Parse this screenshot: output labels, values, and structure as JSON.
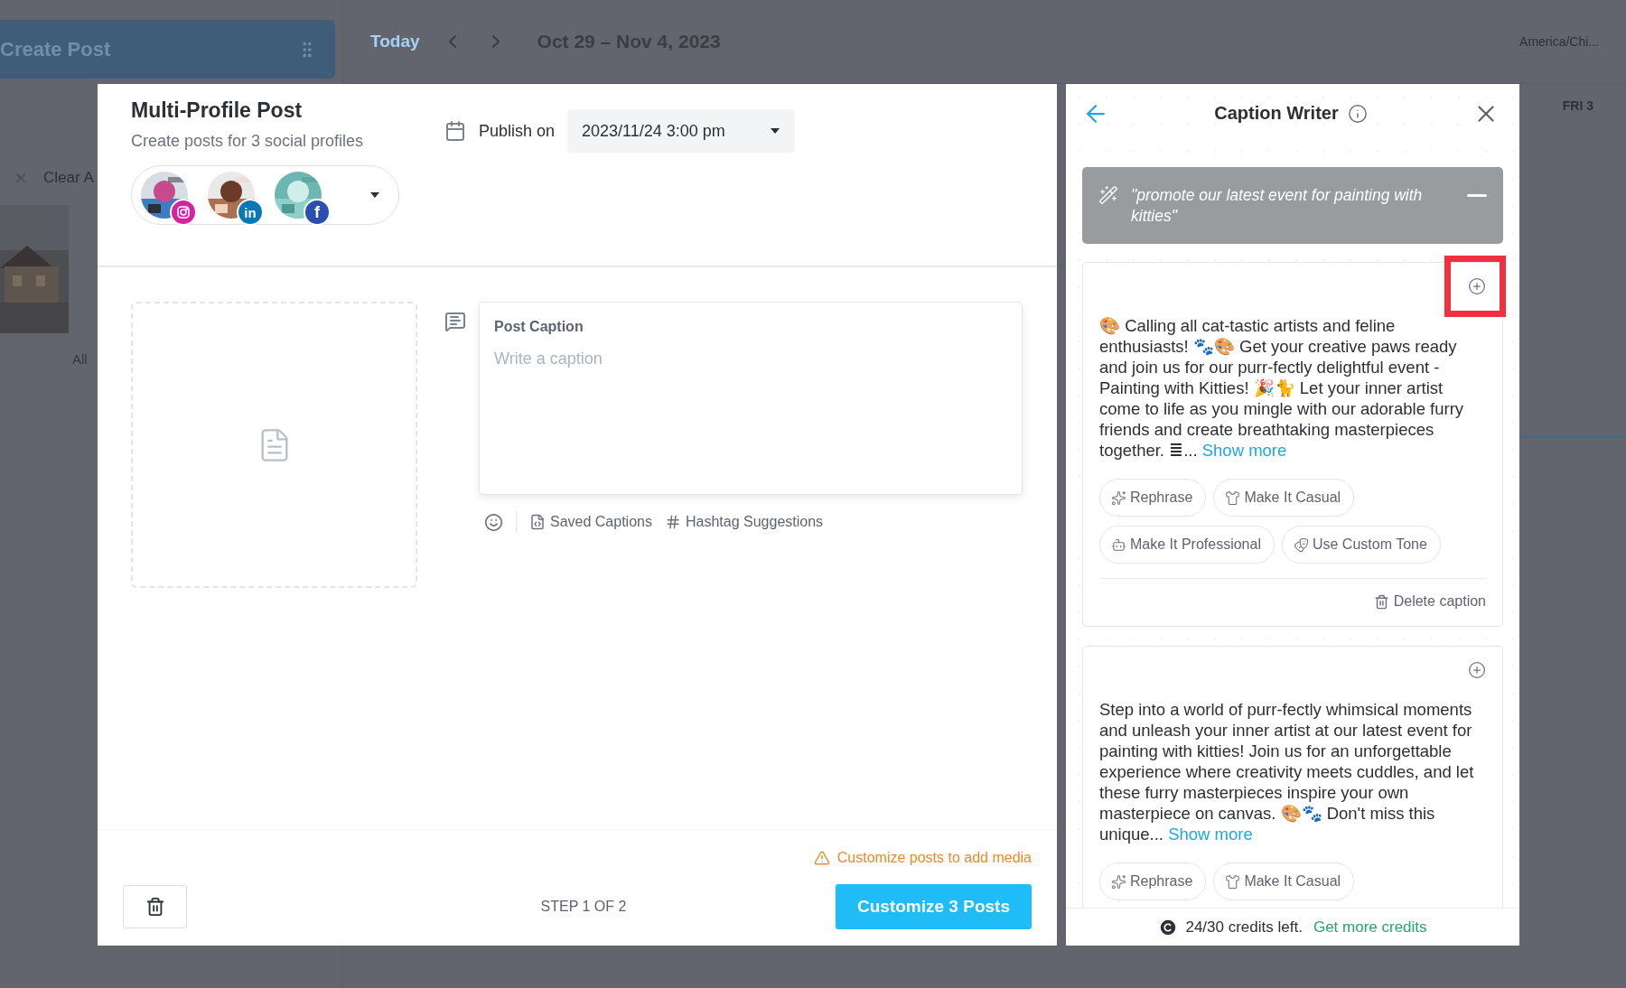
{
  "background": {
    "create_button": "Create Post",
    "today": "Today",
    "date_range": "Oct 29 – Nov 4, 2023",
    "timezone": "America/Chi...",
    "day_header": "FRI 3",
    "clear_filter": "Clear A",
    "grid_label": "All"
  },
  "post_modal": {
    "title": "Multi-Profile Post",
    "subtitle": "Create posts for 3 social profiles",
    "publish_label": "Publish on",
    "publish_date": "2023/11/24 3:00 pm",
    "profiles": [
      {
        "kind": "instagram"
      },
      {
        "kind": "linkedin",
        "badge": "in"
      },
      {
        "kind": "facebook",
        "badge": "f"
      }
    ],
    "caption": {
      "label": "Post Caption",
      "placeholder": "Write a caption"
    },
    "tools": [
      {
        "kind": "emoji"
      },
      {
        "kind": "saved",
        "label": "Saved Captions"
      },
      {
        "kind": "hashtag",
        "label": "Hashtag Suggestions"
      }
    ],
    "warning": "Customize posts to add media",
    "step": "STEP 1 OF 2",
    "primary_button": "Customize 3 Posts"
  },
  "caption_writer": {
    "title": "Caption Writer",
    "prompt": "\"promote our latest event for painting with kitties\"",
    "captions": [
      {
        "highlighted": true,
        "text": "🎨 Calling all cat-tastic artists and feline enthusiasts! 🐾🎨 Get your creative paws ready and join us for our purr-fectly delightful event - Painting with Kitties! 🎉🐈 Let your inner artist come to life as you mingle with our adorable furry friends and create breathtaking masterpieces together. ≣...",
        "more": "Show more",
        "actions": [
          {
            "kind": "rephrase",
            "label": "Rephrase"
          },
          {
            "kind": "casual",
            "label": "Make It Casual"
          },
          {
            "kind": "professional",
            "label": "Make It Professional"
          },
          {
            "kind": "custom",
            "label": "Use Custom Tone"
          }
        ],
        "delete": "Delete caption"
      },
      {
        "highlighted": false,
        "text": "Step into a world of purr-fectly whimsical moments and unleash your inner artist at our latest event for painting with kitties! Join us for an unforgettable experience where creativity meets cuddles, and let these furry masterpieces inspire your own masterpiece on canvas. 🎨🐾 Don't miss this unique...",
        "more": "Show more",
        "actions": [
          {
            "kind": "rephrase",
            "label": "Rephrase"
          },
          {
            "kind": "casual",
            "label": "Make It Casual"
          }
        ]
      }
    ],
    "credits": "24/30 credits left.",
    "credits_link": "Get more credits"
  }
}
